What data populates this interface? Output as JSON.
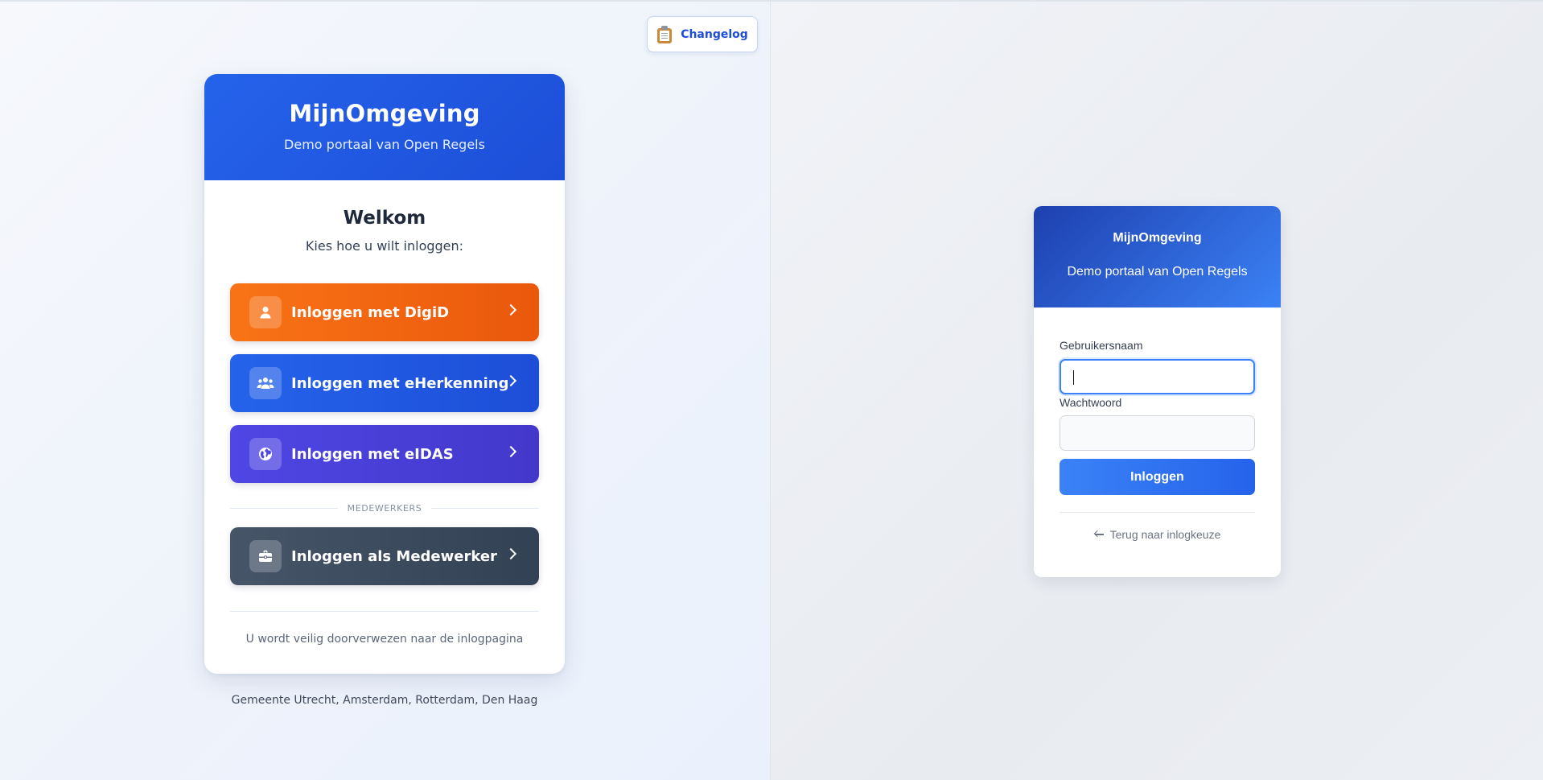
{
  "changelog": {
    "label": "Changelog",
    "icon": "clipboard-icon"
  },
  "portal": {
    "title": "MijnOmgeving",
    "subtitle": "Demo portaal van Open Regels",
    "welcome": "Welkom",
    "prompt": "Kies hoe u wilt inloggen:",
    "options": [
      {
        "label": "Inloggen met DigiD",
        "icon": "user-icon",
        "color": "#f97316"
      },
      {
        "label": "Inloggen met eHerkenning",
        "icon": "users-icon",
        "color": "#2563eb"
      },
      {
        "label": "Inloggen met eIDAS",
        "icon": "globe-icon",
        "color": "#4f46e5"
      }
    ],
    "separator": "MEDEWERKERS",
    "employee": {
      "label": "Inloggen als Medewerker",
      "icon": "briefcase-icon",
      "color": "#475569"
    },
    "secure_note": "U wordt veilig doorverwezen naar de inlogpagina",
    "municipalities": "Gemeente Utrecht, Amsterdam, Rotterdam, Den Haag"
  },
  "login_form": {
    "title": "MijnOmgeving",
    "subtitle": "Demo portaal van Open Regels",
    "username_label": "Gebruikersnaam",
    "username_value": "",
    "password_label": "Wachtwoord",
    "password_value": "",
    "submit_label": "Inloggen",
    "back_label": "Terug naar inlogkeuze"
  }
}
